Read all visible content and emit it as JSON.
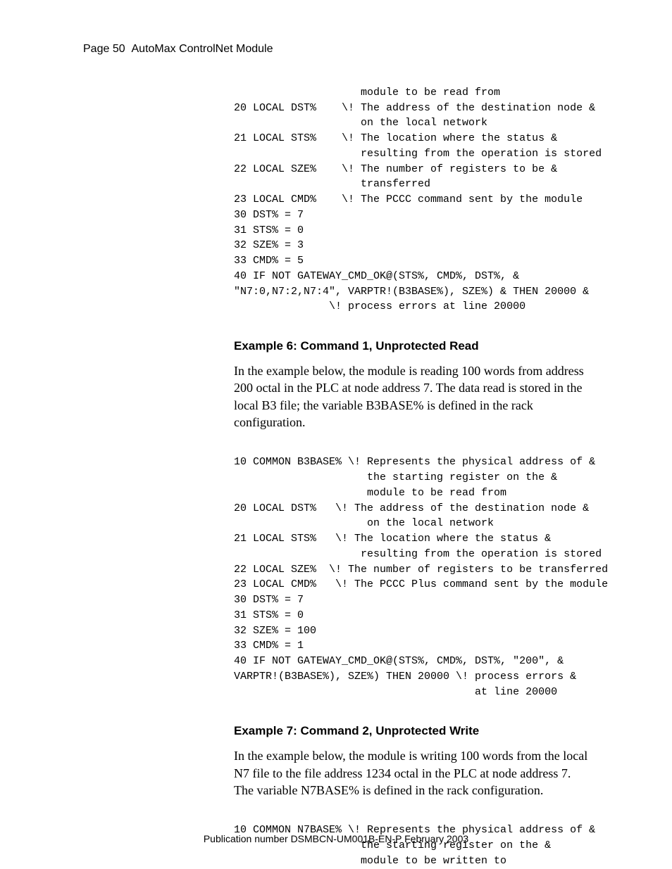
{
  "header": {
    "page_label": "Page 50",
    "title": "AutoMax ControlNet Module"
  },
  "code1": "                    module to be read from\n20 LOCAL DST%    \\! The address of the destination node &\n                    on the local network\n21 LOCAL STS%    \\! The location where the status &\n                    resulting from the operation is stored\n22 LOCAL SZE%    \\! The number of registers to be &\n                    transferred\n23 LOCAL CMD%    \\! The PCCC command sent by the module\n30 DST% = 7\n31 STS% = 0\n32 SZE% = 3\n33 CMD% = 5\n40 IF NOT GATEWAY_CMD_OK@(STS%, CMD%, DST%, &\n\"N7:0,N7:2,N7:4\", VARPTR!(B3BASE%), SZE%) & THEN 20000 &\n               \\! process errors at line 20000",
  "example6": {
    "heading": "Example 6: Command 1, Unprotected Read",
    "para": "In the example below, the module is reading 100 words from address 200 octal in the PLC at node address 7. The data read is stored in the local B3 file; the variable B3BASE% is defined in the rack configuration."
  },
  "code2": "10 COMMON B3BASE% \\! Represents the physical address of &\n                     the starting register on the &\n                     module to be read from\n20 LOCAL DST%   \\! The address of the destination node &\n                     on the local network\n21 LOCAL STS%   \\! The location where the status &\n                    resulting from the operation is stored\n22 LOCAL SZE%  \\! The number of registers to be transferred\n23 LOCAL CMD%   \\! The PCCC Plus command sent by the module\n30 DST% = 7\n31 STS% = 0\n32 SZE% = 100\n33 CMD% = 1\n40 IF NOT GATEWAY_CMD_OK@(STS%, CMD%, DST%, \"200\", &\nVARPTR!(B3BASE%), SZE%) THEN 20000 \\! process errors &\n                                      at line 20000",
  "example7": {
    "heading": "Example 7: Command 2, Unprotected Write",
    "para": "In the example below, the module is writing 100 words from the local N7 file to the file address 1234 octal in the PLC at node address 7. The variable N7BASE% is defined in the rack configuration."
  },
  "code3": "10 COMMON N7BASE% \\! Represents the physical address of &\n                    the starting register on the &\n                    module to be written to",
  "footer": {
    "text": "Publication number DSMBCN-UM001B-EN-P February 2003"
  }
}
